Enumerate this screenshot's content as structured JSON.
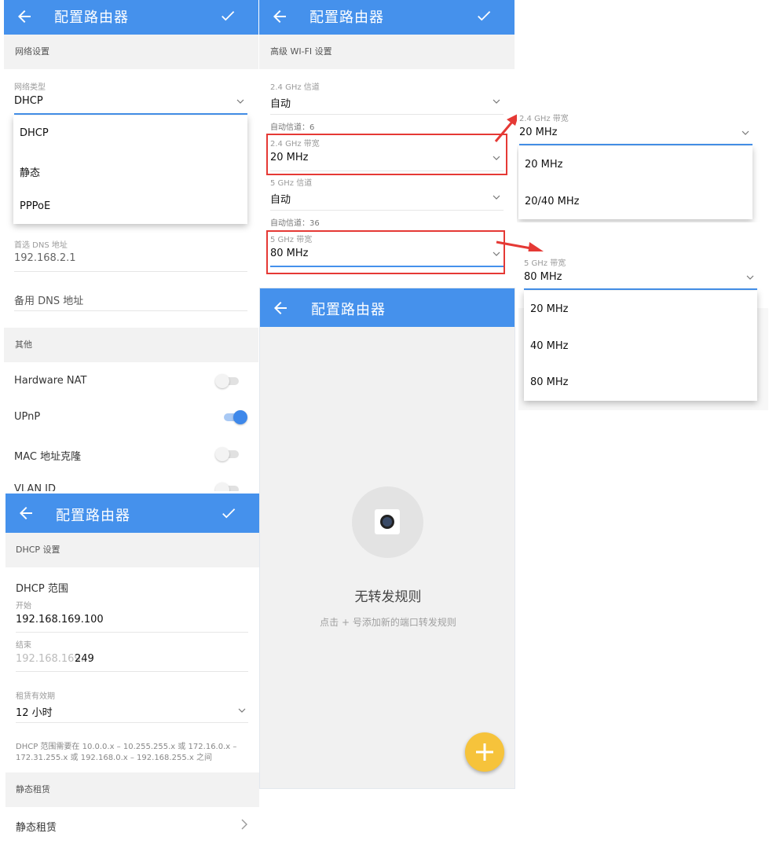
{
  "app_title": "配置路由器",
  "panel_network": {
    "section_network": "网络设置",
    "network_type_label": "网络类型",
    "network_type_value": "DHCP",
    "network_type_options": [
      "DHCP",
      "静态",
      "PPPoE"
    ],
    "primary_dns_label": "首选 DNS 地址",
    "primary_dns_value": "192.168.2.1",
    "secondary_dns_placeholder": "备用 DNS 地址",
    "section_other": "其他",
    "toggles": [
      {
        "label": "Hardware NAT",
        "on": false
      },
      {
        "label": "UPnP",
        "on": true
      },
      {
        "label": "MAC 地址克隆",
        "on": false
      },
      {
        "label": "VLAN ID",
        "on": false
      }
    ]
  },
  "panel_wifi": {
    "section": "高级 WI-FI 设置",
    "ch24_label": "2.4 GHz 信道",
    "ch24_value": "自动",
    "ch24_auto": "自动信道：6",
    "bw24_label": "2.4 GHz 带宽",
    "bw24_value": "20 MHz",
    "ch5_label": "5 GHz 信道",
    "ch5_value": "自动",
    "ch5_auto": "自动信道：36",
    "bw5_label": "5 GHz 带宽",
    "bw5_value": "80 MHz"
  },
  "popup_24": {
    "label": "2.4 GHz 带宽",
    "value": "20 MHz",
    "options": [
      "20 MHz",
      "20/40 MHz"
    ]
  },
  "popup_5": {
    "label": "5 GHz 带宽",
    "value": "80 MHz",
    "options": [
      "20 MHz",
      "40 MHz",
      "80 MHz"
    ]
  },
  "panel_forward": {
    "empty_title": "无转发规则",
    "empty_hint": "点击 + 号添加新的端口转发规则"
  },
  "panel_dhcp": {
    "section_dhcp": "DHCP 设置",
    "range_title": "DHCP 范围",
    "start_label": "开始",
    "start_value": "192.168.169.100",
    "end_label": "结束",
    "end_prefix": "192.168.169.",
    "end_value": "249",
    "lease_label": "租赁有效期",
    "lease_value": "12 小时",
    "range_note_1": "DHCP 范围需要在 10.0.0.x – 10.255.255.x 或 172.16.0.x –",
    "range_note_2": "172.31.255.x 或 192.168.0.x – 192.168.255.x 之间",
    "section_static": "静态租赁",
    "static_item": "静态租赁"
  },
  "colors": {
    "primary": "#4591ec",
    "accent_fab": "#f6c33b",
    "highlight": "#e53935"
  },
  "icons": [
    "back-arrow-icon",
    "check-icon",
    "chevron-down-icon",
    "chevron-right-icon",
    "camera-icon",
    "plus-icon",
    "red-arrow-icon"
  ]
}
